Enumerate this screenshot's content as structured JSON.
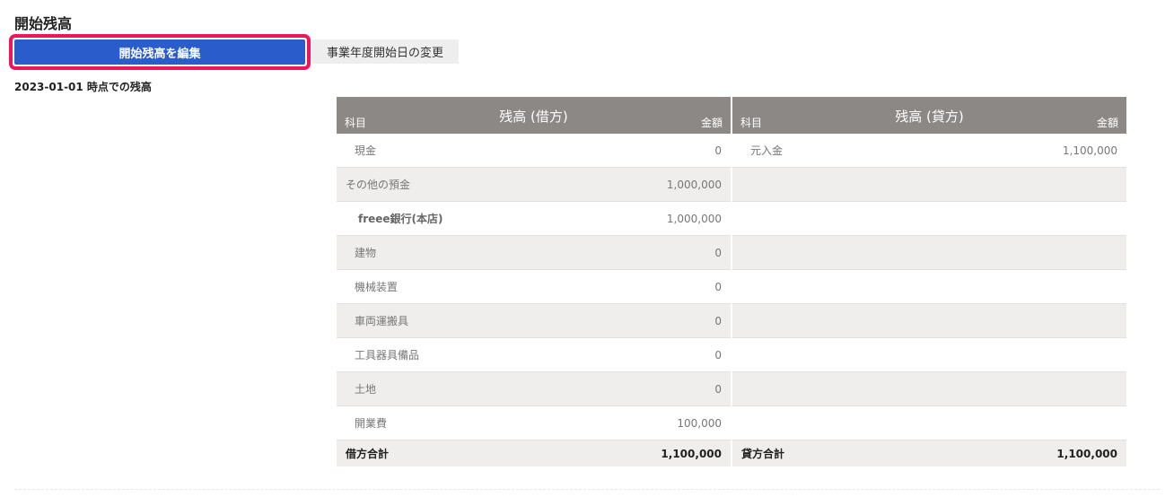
{
  "page": {
    "title": "開始残高",
    "as_of": "2023-01-01 時点での残高"
  },
  "buttons": {
    "edit_label": "開始残高を編集",
    "change_label": "事業年度開始日の変更"
  },
  "debit": {
    "title": "残高 (借方)",
    "col_account": "科目",
    "col_amount": "金額",
    "rows": [
      {
        "name": "現金",
        "amount": "0"
      },
      {
        "name": "その他の預金",
        "amount": "1,000,000"
      },
      {
        "name": "freee銀行(本店)",
        "amount": "1,000,000"
      },
      {
        "name": "建物",
        "amount": "0"
      },
      {
        "name": "機械装置",
        "amount": "0"
      },
      {
        "name": "車両運搬具",
        "amount": "0"
      },
      {
        "name": "工具器具備品",
        "amount": "0"
      },
      {
        "name": "土地",
        "amount": "0"
      },
      {
        "name": "開業費",
        "amount": "100,000"
      }
    ],
    "total_label": "借方合計",
    "total_amount": "1,100,000"
  },
  "credit": {
    "title": "残高 (貸方)",
    "col_account": "科目",
    "col_amount": "金額",
    "rows": [
      {
        "name": "元入金",
        "amount": "1,100,000"
      }
    ],
    "total_label": "貸方合計",
    "total_amount": "1,100,000"
  }
}
